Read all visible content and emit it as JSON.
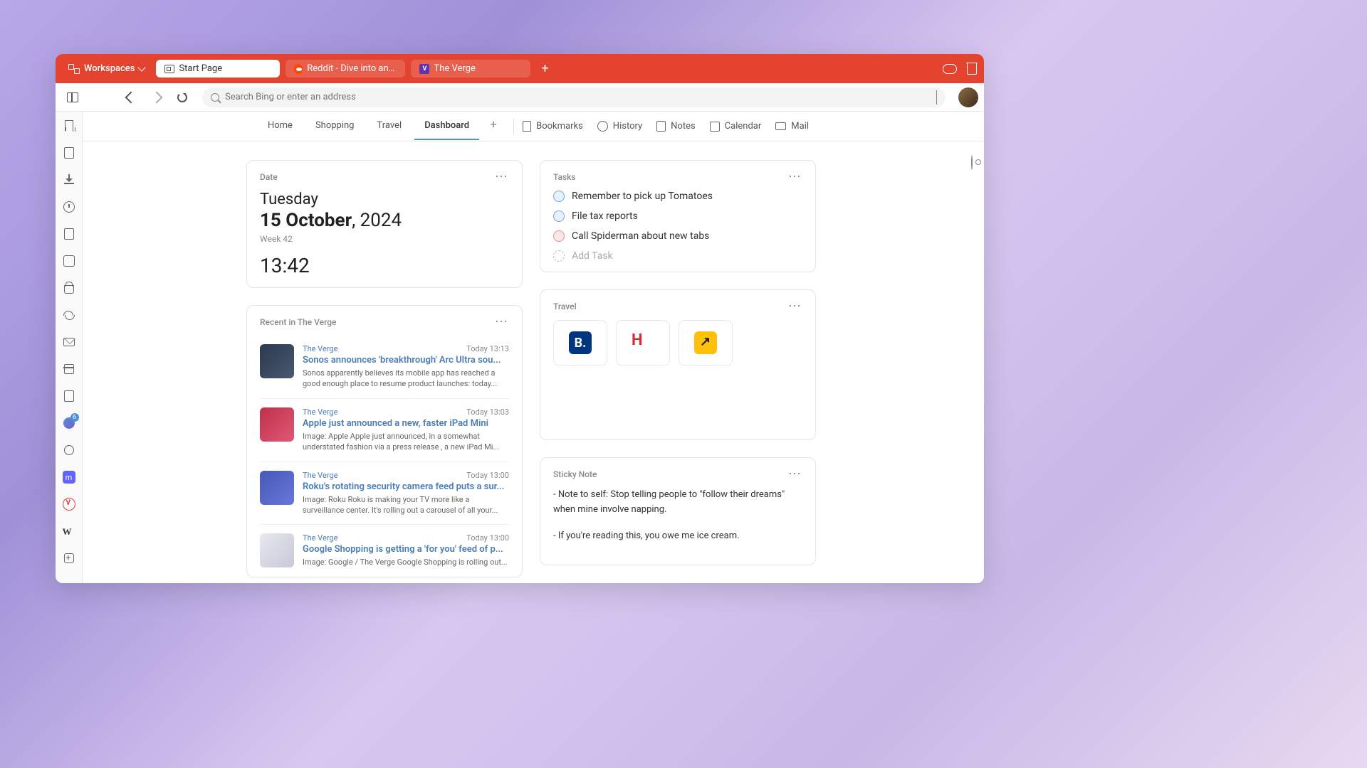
{
  "titlebar": {
    "workspaces_label": "Workspaces",
    "tabs": [
      {
        "label": "Start Page"
      },
      {
        "label": "Reddit - Dive into anything"
      },
      {
        "label": "The Verge"
      }
    ]
  },
  "toolbar": {
    "address_placeholder": "Search Bing or enter an address"
  },
  "panel": {
    "feed_badge": "6"
  },
  "page_nav": {
    "left": [
      "Home",
      "Shopping",
      "Travel",
      "Dashboard"
    ],
    "right": [
      "Bookmarks",
      "History",
      "Notes",
      "Calendar",
      "Mail"
    ]
  },
  "widgets": {
    "date": {
      "title": "Date",
      "day": "Tuesday",
      "date_strong": "15 October",
      "date_rest": ", 2024",
      "week": "Week 42",
      "time": "13:42"
    },
    "tasks": {
      "title": "Tasks",
      "items": [
        {
          "label": "Remember to pick up Tomatoes",
          "color": "blue"
        },
        {
          "label": "File tax reports",
          "color": "blue"
        },
        {
          "label": "Call Spiderman about new tabs",
          "color": "pink"
        }
      ],
      "add_label": "Add Task"
    },
    "feed": {
      "title": "Recent in The Verge",
      "items": [
        {
          "source": "The Verge",
          "time": "Today 13:13",
          "headline": "Sonos announces 'breakthrough' Arc Ultra sou...",
          "desc": "Sonos apparently believes its mobile app has reached a good enough place to resume product launches: today..."
        },
        {
          "source": "The Verge",
          "time": "Today 13:03",
          "headline": "Apple just announced a new, faster iPad Mini",
          "desc": "Image: Apple Apple just announced, in a somewhat understated fashion via a press release , a new iPad Mi..."
        },
        {
          "source": "The Verge",
          "time": "Today 13:00",
          "headline": "Roku's rotating security camera feed puts a sur...",
          "desc": "Image: Roku Roku is making your TV more like a surveillance center. It's rolling out a carousel of all your..."
        },
        {
          "source": "The Verge",
          "time": "Today 13:00",
          "headline": "Google Shopping is getting a 'for you' feed of p...",
          "desc": "Image: Google / The Verge Google Shopping is rolling out..."
        }
      ]
    },
    "travel": {
      "title": "Travel",
      "items": [
        "booking",
        "hotels",
        "expedia"
      ]
    },
    "sticky": {
      "title": "Sticky Note",
      "lines": [
        "- Note to self: Stop telling people to \"follow their dreams\" when mine involve napping.",
        "- If you're reading this, you owe me ice cream."
      ]
    }
  }
}
